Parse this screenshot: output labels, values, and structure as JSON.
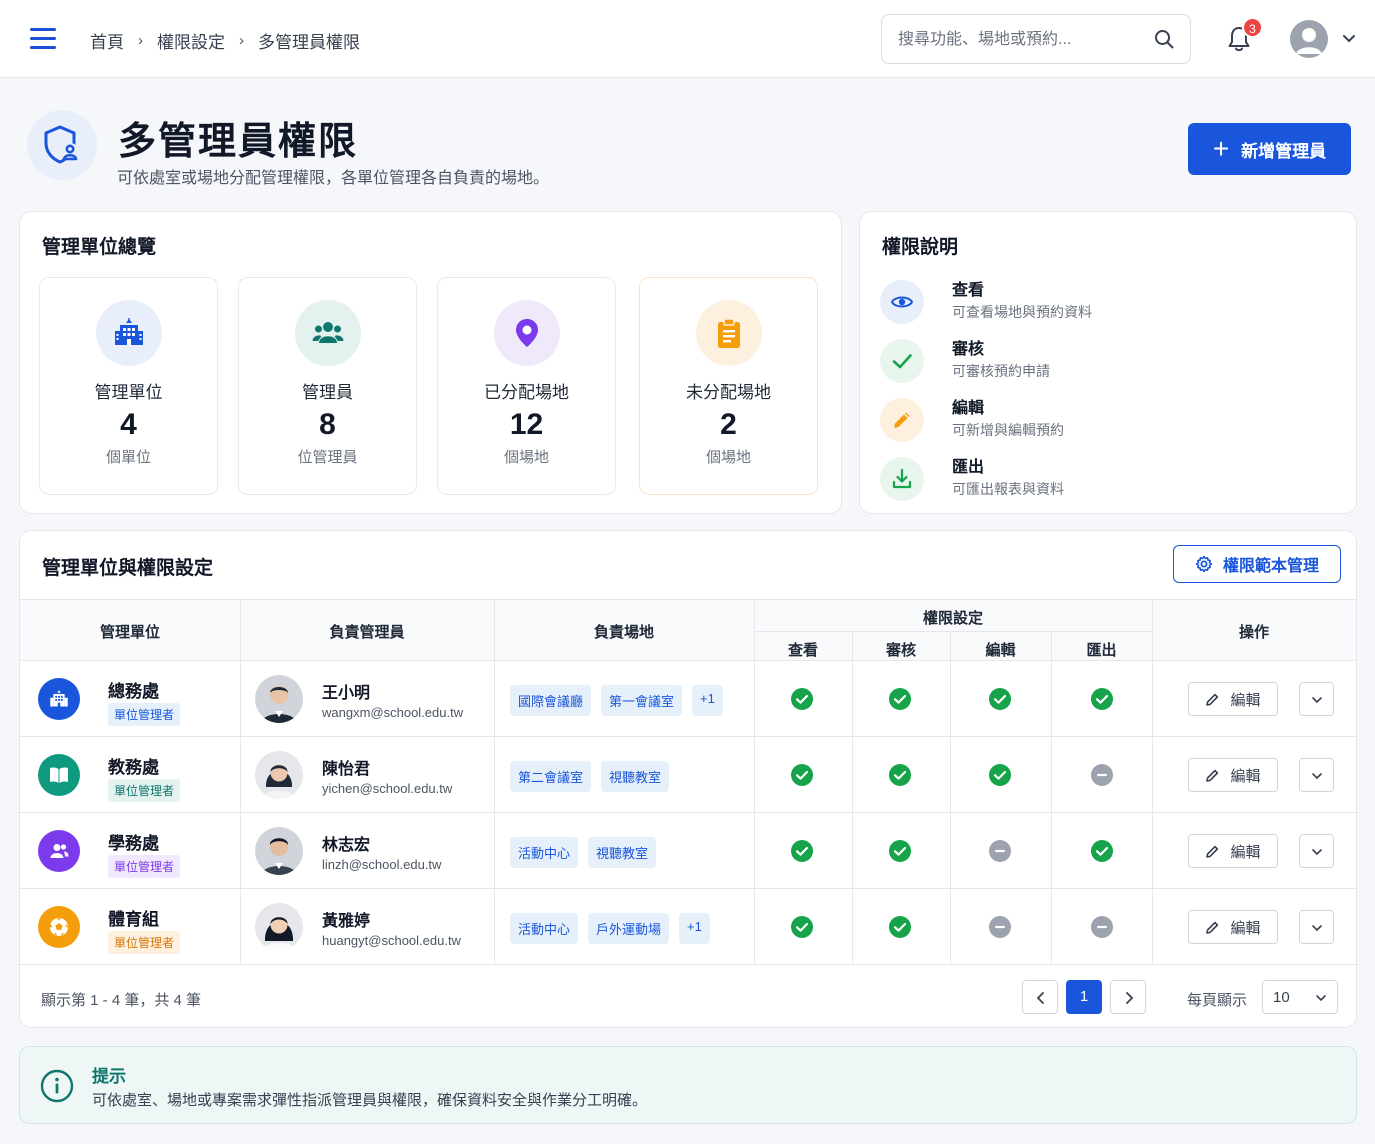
{
  "topbar": {
    "breadcrumb": [
      "首頁",
      "權限設定",
      "多管理員權限"
    ],
    "breadcrumb_sep": "›",
    "search_placeholder": "搜尋功能、場地或預約...",
    "notification_count": "3"
  },
  "header": {
    "title": "多管理員權限",
    "subtitle": "可依處室或場地分配管理權限，各單位管理各自負責的場地。",
    "add_button": "新增管理員",
    "add_icon": "+"
  },
  "overview": {
    "title": "管理單位總覽",
    "stats": [
      {
        "label": "管理單位",
        "value": "4",
        "unit": "個單位",
        "icon": "building-icon",
        "color": "#1a56db",
        "bg": "#e8eefa"
      },
      {
        "label": "管理員",
        "value": "8",
        "unit": "位管理員",
        "icon": "users-icon",
        "color": "#0f766e",
        "bg": "#e3f2ef"
      },
      {
        "label": "已分配場地",
        "value": "12",
        "unit": "個場地",
        "icon": "map-pin-icon",
        "color": "#7c3aed",
        "bg": "#efe9fb"
      },
      {
        "label": "未分配場地",
        "value": "2",
        "unit": "個場地",
        "icon": "clipboard-icon",
        "color": "#f59e0b",
        "bg": "#fdf0de"
      }
    ]
  },
  "permissions": {
    "title": "權限說明",
    "items": [
      {
        "name": "查看",
        "desc": "可查看場地與預約資料",
        "icon": "eye-icon",
        "color": "#1a56db",
        "bg": "#e8eefa"
      },
      {
        "name": "審核",
        "desc": "可審核預約申請",
        "icon": "check-icon",
        "color": "#16a34a",
        "bg": "#e7f5ec"
      },
      {
        "name": "編輯",
        "desc": "可新增與編輯預約",
        "icon": "pencil-icon",
        "color": "#f59e0b",
        "bg": "#fdf0de"
      },
      {
        "name": "匯出",
        "desc": "可匯出報表與資料",
        "icon": "download-icon",
        "color": "#16a34a",
        "bg": "#e7f5ec"
      }
    ]
  },
  "table": {
    "title": "管理單位與權限設定",
    "template_button": "權限範本管理",
    "headers": {
      "unit": "管理單位",
      "manager": "負責管理員",
      "venues": "負責場地",
      "permissions": "權限設定",
      "view": "查看",
      "approve": "審核",
      "edit": "編輯",
      "export": "匯出",
      "actions": "操作"
    },
    "edit_label": "編輯",
    "rows": [
      {
        "unit": "總務處",
        "role": "單位管理者",
        "unit_icon": "building-icon",
        "unit_color": "#1a56db",
        "role_color": "#1a56db",
        "role_bg": "#e6f0fb",
        "manager": "王小明",
        "email": "wangxm@school.edu.tw",
        "venues": [
          "國際會議廳",
          "第一會議室",
          "+1"
        ],
        "perms": {
          "view": true,
          "approve": true,
          "edit": true,
          "export": true
        }
      },
      {
        "unit": "教務處",
        "role": "單位管理者",
        "unit_icon": "book-icon",
        "unit_color": "#0f9a7f",
        "role_color": "#0f766e",
        "role_bg": "#e3f2ef",
        "manager": "陳怡君",
        "email": "yichen@school.edu.tw",
        "venues": [
          "第二會議室",
          "視聽教室"
        ],
        "perms": {
          "view": true,
          "approve": true,
          "edit": true,
          "export": false
        }
      },
      {
        "unit": "學務處",
        "role": "單位管理者",
        "unit_icon": "users-icon",
        "unit_color": "#7c3aed",
        "role_color": "#7c3aed",
        "role_bg": "#efe9fb",
        "manager": "林志宏",
        "email": "linzh@school.edu.tw",
        "venues": [
          "活動中心",
          "視聽教室"
        ],
        "perms": {
          "view": true,
          "approve": true,
          "edit": false,
          "export": true
        }
      },
      {
        "unit": "體育組",
        "role": "單位管理者",
        "unit_icon": "ball-icon",
        "unit_color": "#f59e0b",
        "role_color": "#d97706",
        "role_bg": "#fdf0de",
        "manager": "黃雅婷",
        "email": "huangyt@school.edu.tw",
        "venues": [
          "活動中心",
          "戶外運動場",
          "+1"
        ],
        "perms": {
          "view": true,
          "approve": true,
          "edit": false,
          "export": false
        }
      }
    ],
    "pagination": {
      "info": "顯示第 1 - 4 筆，共 4 筆",
      "current_page": "1",
      "per_page_label": "每頁顯示",
      "per_page_value": "10"
    }
  },
  "tip": {
    "title": "提示",
    "text": "可依處室、場地或專案需求彈性指派管理員與權限，確保資料安全與作業分工明確。"
  },
  "colors": {
    "primary": "#1a56db",
    "success": "#16a34a",
    "disabled": "#9ca3af"
  }
}
